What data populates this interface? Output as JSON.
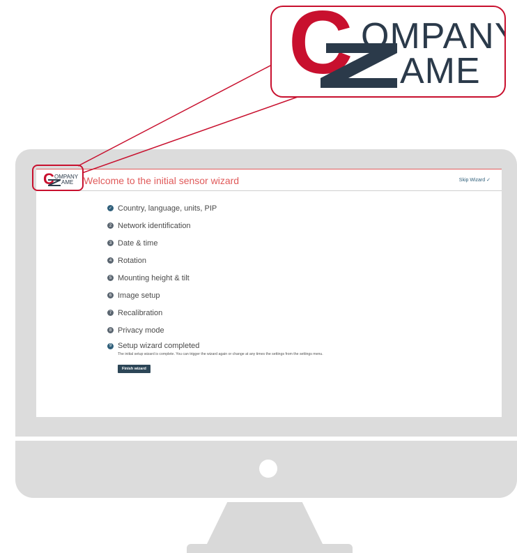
{
  "brand": {
    "logo_letter": "C",
    "logo_line1": "OMPANY",
    "logo_line2": "AME",
    "accent_color": "#c8102e",
    "text_color": "#2b3a4a"
  },
  "header": {
    "title": "Welcome to the initial sensor wizard",
    "skip_label": "Skip Wizard",
    "skip_icon": "checkmark-icon"
  },
  "steps": [
    {
      "number": "✓",
      "label": "Country, language, units, PIP",
      "state": "done"
    },
    {
      "number": "2",
      "label": "Network identification",
      "state": "pending"
    },
    {
      "number": "3",
      "label": "Date & time",
      "state": "pending"
    },
    {
      "number": "4",
      "label": "Rotation",
      "state": "pending"
    },
    {
      "number": "5",
      "label": "Mounting height & tilt",
      "state": "pending"
    },
    {
      "number": "6",
      "label": "Image setup",
      "state": "pending"
    },
    {
      "number": "7",
      "label": "Recalibration",
      "state": "pending"
    },
    {
      "number": "8",
      "label": "Privacy mode",
      "state": "pending"
    },
    {
      "number": "9",
      "label": "Setup wizard completed",
      "state": "current"
    }
  ],
  "completion": {
    "message": "The initial setup wizard is complete. You can trigger the wizard again or change at any times the settings from the settings menu.",
    "button_label": "Finish wizard"
  },
  "colors": {
    "header_accent": "#e05a5a",
    "step_done": "#2f5f7a",
    "button_bg": "#2c4657"
  }
}
